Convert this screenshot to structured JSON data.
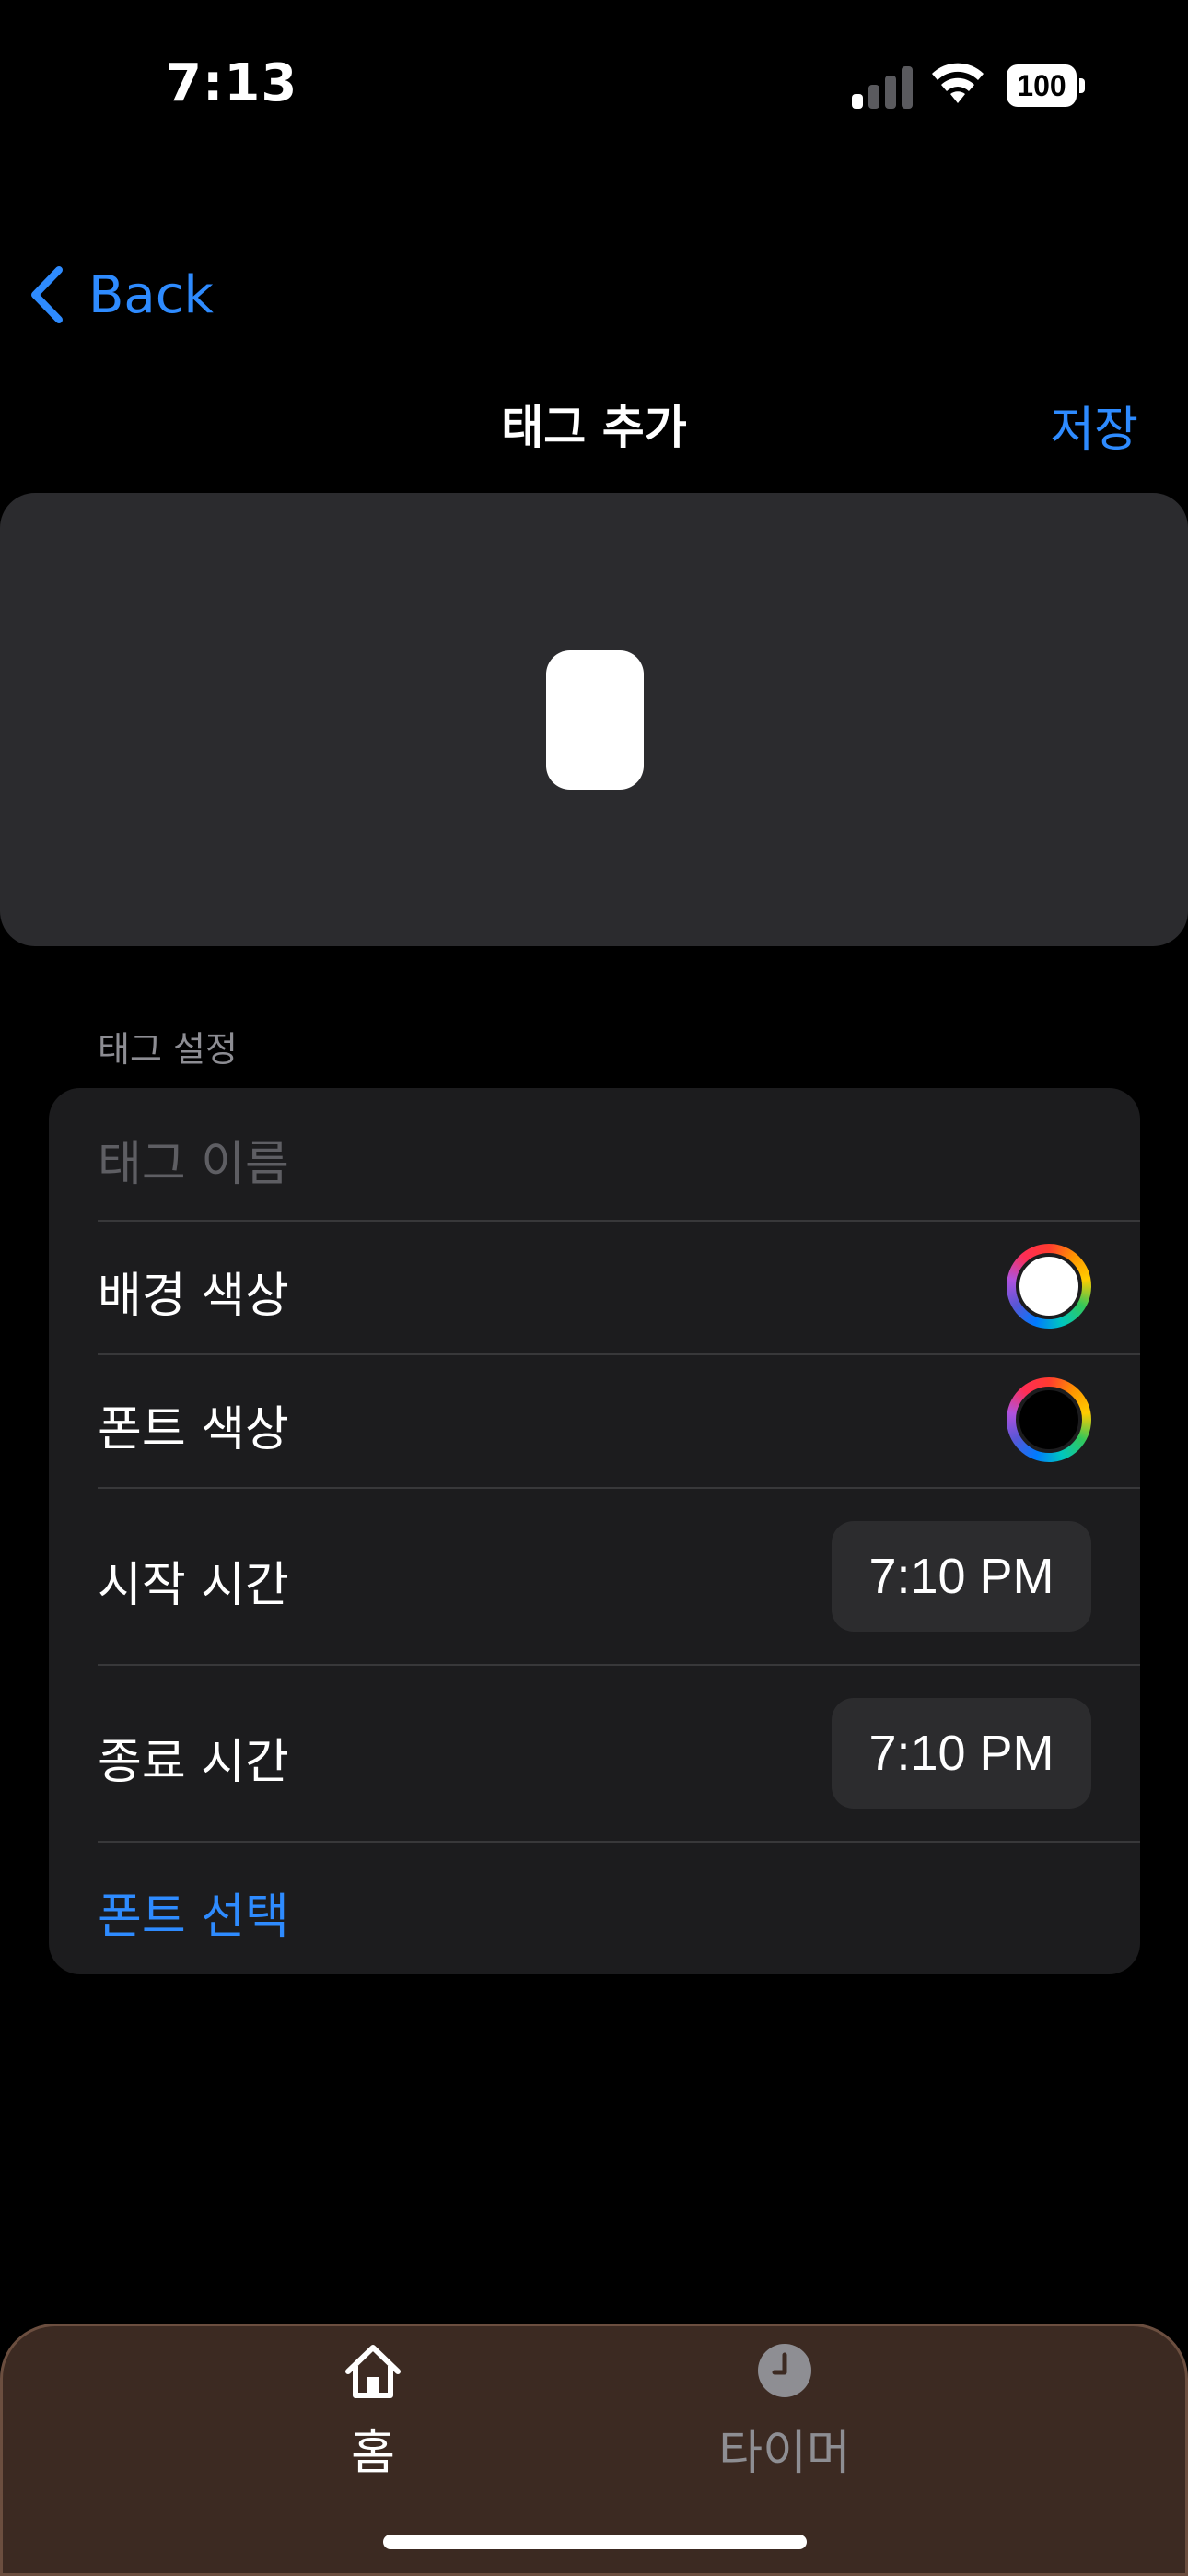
{
  "status_bar": {
    "time": "7:13",
    "battery": "100"
  },
  "nav": {
    "back_label": "Back",
    "title": "태그 추가",
    "save_label": "저장"
  },
  "preview": {
    "tag_color": "#ffffff"
  },
  "section": {
    "header": "태그 설정",
    "name_placeholder": "태그 이름",
    "background_color_label": "배경 색상",
    "background_color_value": "#ffffff",
    "font_color_label": "폰트 색상",
    "font_color_value": "#000000",
    "start_time_label": "시작 시간",
    "start_time_value": "7:10 PM",
    "end_time_label": "종료 시간",
    "end_time_value": "7:10 PM",
    "font_select_label": "폰트 선택"
  },
  "tabbar": {
    "tabs": [
      {
        "label": "홈",
        "icon": "house-icon",
        "selected": true
      },
      {
        "label": "타이머",
        "icon": "clock-icon",
        "selected": false
      }
    ]
  },
  "colors": {
    "accent": "#2e8bff",
    "tabbar_bg": "#3c2a22",
    "selected_tab": "#ffffff",
    "unselected_tab": "#8e8e93"
  }
}
